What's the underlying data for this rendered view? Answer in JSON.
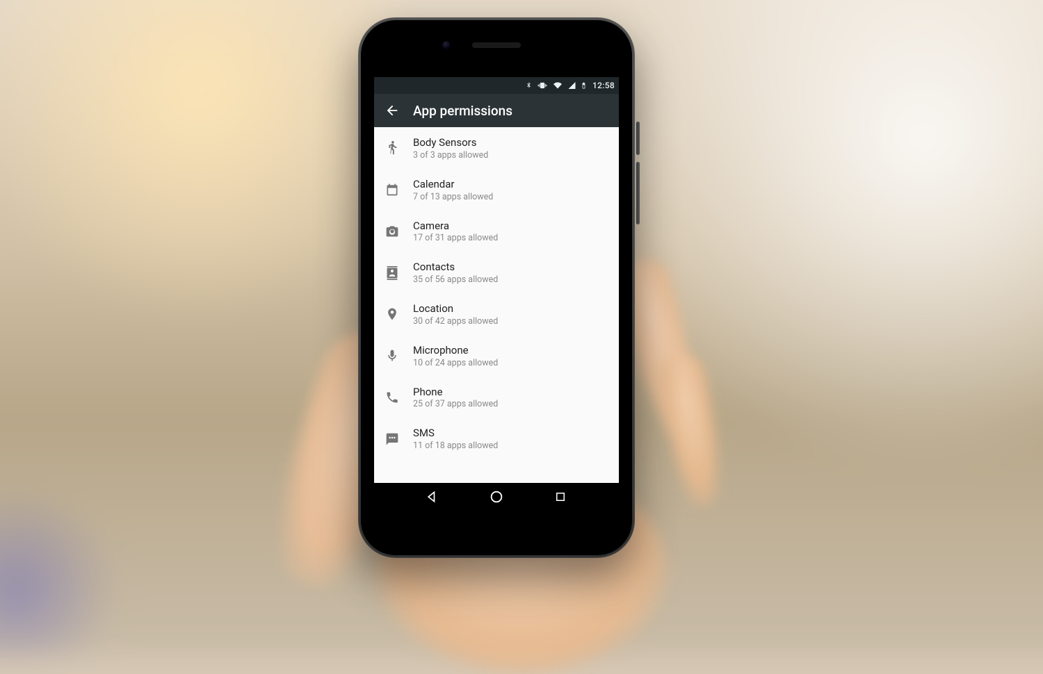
{
  "statusbar": {
    "time": "12:58",
    "icons": {
      "bluetooth": "bluetooth-icon",
      "vibrate": "vibrate-icon",
      "wifi": "wifi-icon",
      "cellular": "cellular-icon",
      "battery": "battery-icon"
    }
  },
  "appbar": {
    "title": "App permissions",
    "back": "back-arrow"
  },
  "permissions": [
    {
      "icon": "body-sensors-icon",
      "label": "Body Sensors",
      "subtitle": "3 of 3 apps allowed"
    },
    {
      "icon": "calendar-icon",
      "label": "Calendar",
      "subtitle": "7 of 13 apps allowed"
    },
    {
      "icon": "camera-icon",
      "label": "Camera",
      "subtitle": "17 of 31 apps allowed"
    },
    {
      "icon": "contacts-icon",
      "label": "Contacts",
      "subtitle": "35 of 56 apps allowed"
    },
    {
      "icon": "location-icon",
      "label": "Location",
      "subtitle": "30 of 42 apps allowed"
    },
    {
      "icon": "microphone-icon",
      "label": "Microphone",
      "subtitle": "10 of 24 apps allowed"
    },
    {
      "icon": "phone-icon",
      "label": "Phone",
      "subtitle": "25 of 37 apps allowed"
    },
    {
      "icon": "sms-icon",
      "label": "SMS",
      "subtitle": "11 of 18 apps allowed"
    }
  ],
  "navbar": {
    "back": "nav-back",
    "home": "nav-home",
    "recents": "nav-recents"
  }
}
